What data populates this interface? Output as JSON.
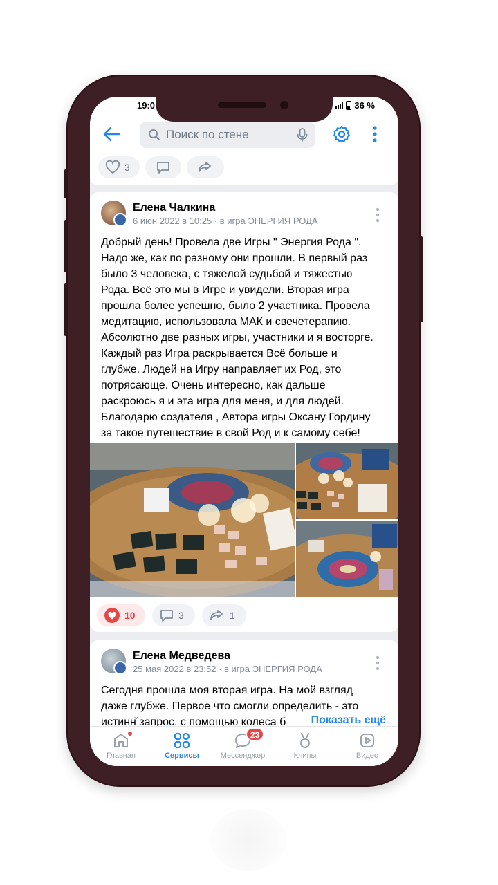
{
  "status": {
    "time": "19:0",
    "battery": "36 %"
  },
  "topbar": {
    "search_placeholder": "Поиск по стене"
  },
  "prev_post": {
    "likes": "3"
  },
  "post1": {
    "author": "Елена Чалкина",
    "meta": "6 июн 2022 в 10:25 · в игра ЭНЕРГИЯ РОДА",
    "lines": [
      "Добрый день! Провела две Игры \" Энергия Рода \".",
      "Надо же, как по разному они прошли. В первый раз",
      "было 3 человека, с тяжёлой судьбой и тяжестью",
      "Рода. Всё это мы в Игре и увидели. Вторая игра",
      "прошла более успешно, было 2 участника. Провела",
      "медитацию, использовала МАК и свечетерапию.",
      "Абсолютно две разных игры, участники и я восторге.",
      "Каждый раз Игра раскрывается Всё больше и",
      "глубже. Людей на Игру направляет их Род, это",
      "потрясающе. Очень интересно, как дальше",
      "раскроюсь я и эта игра для меня, и для людей.",
      "Благодарю создателя , Автора игры Оксану Гордину",
      "за такое путешествие в свой Род и к самому себе!"
    ],
    "likes": "10",
    "comments": "3",
    "reposts": "1"
  },
  "post2": {
    "author": "Елена Медведева",
    "meta": "25 мая 2022 в 23:52 · в игра ЭНЕРГИЯ РОДА",
    "lines": [
      "Сегодня прошла моя вторая игра. На мой взгляд",
      "даже глубже. Первое что смогли определить - это",
      "истинн̆ запрос, с помощью колеса б"
    ],
    "show_more": "Показать ещё"
  },
  "nav": {
    "items": [
      {
        "label": "Главная",
        "icon": "home-icon"
      },
      {
        "label": "Сервисы",
        "icon": "services-icon"
      },
      {
        "label": "Мессенджер",
        "icon": "messenger-icon"
      },
      {
        "label": "Клипы",
        "icon": "clips-icon"
      },
      {
        "label": "Видео",
        "icon": "video-icon"
      }
    ],
    "messenger_badge": "23"
  },
  "colors": {
    "accent": "#2688eb",
    "like_red": "#e64646",
    "frame": "#3d1f25"
  }
}
